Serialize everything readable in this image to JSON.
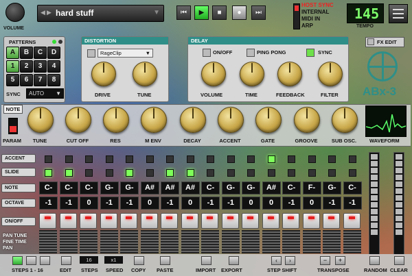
{
  "header": {
    "volume_label": "VOLUME",
    "preset_name": "hard stuff",
    "transport": [
      "⏮",
      "▶",
      "■",
      "●",
      "⏭"
    ],
    "sync_modes": [
      "HOST SYNC",
      "INTERNAL",
      "MIDI IN",
      "ARP"
    ],
    "tempo_value": "145",
    "tempo_label": "TEMPO"
  },
  "patterns": {
    "title": "PATTERNS",
    "letters": [
      "A",
      "B",
      "C",
      "D"
    ],
    "numbers": [
      "1",
      "2",
      "3",
      "4",
      "5",
      "6",
      "7",
      "8"
    ],
    "sync_label": "SYNC",
    "sync_value": "AUTO"
  },
  "distortion": {
    "title": "DISTORTION",
    "type": "RageClip",
    "knobs": [
      "DRIVE",
      "TUNE"
    ]
  },
  "delay": {
    "title": "DELAY",
    "toggles": [
      "ON/OFF",
      "PING PONG",
      "SYNC"
    ],
    "knobs": [
      "VOLUME",
      "TIME",
      "FEEDBACK",
      "FILTER"
    ]
  },
  "fx_edit_label": "FX EDIT",
  "logo_text": "ABx-3",
  "synth": {
    "note_label": "NOTE",
    "param_label": "PARAM",
    "knobs": [
      "TUNE",
      "CUT OFF",
      "RES",
      "M ENV",
      "DECAY",
      "ACCENT",
      "GATE",
      "GROOVE",
      "SUB OSC."
    ],
    "waveform_label": "WAVEFORM"
  },
  "sequencer": {
    "row_labels": [
      "ACCENT",
      "SLIDE",
      "NOTE",
      "OCTAVE",
      "ON/OFF"
    ],
    "fine_labels": [
      "PAN TUNE",
      "FINE TIME",
      "PAN"
    ],
    "accent": [
      0,
      0,
      0,
      0,
      0,
      0,
      0,
      0,
      0,
      0,
      0,
      1,
      0,
      0,
      0,
      0
    ],
    "slide": [
      1,
      1,
      0,
      0,
      1,
      0,
      1,
      1,
      0,
      0,
      0,
      0,
      0,
      0,
      0,
      0
    ],
    "notes": [
      "C-",
      "C-",
      "C-",
      "G-",
      "G-",
      "A#",
      "A#",
      "A#",
      "C-",
      "G-",
      "G-",
      "A#",
      "C-",
      "F-",
      "G-",
      "C-"
    ],
    "octaves": [
      "-1",
      "-1",
      "0",
      "-1",
      "-1",
      "0",
      "-1",
      "0",
      "-1",
      "-1",
      "0",
      "0",
      "-1",
      "0",
      "-1",
      "-1"
    ]
  },
  "footer": {
    "steps_range": "STEPS 1 - 16",
    "edit": "EDIT",
    "steps": "STEPS",
    "steps_value": "16",
    "speed": "SPEED",
    "speed_value": "x1",
    "copy": "COPY",
    "paste": "PASTE",
    "import": "IMPORT",
    "export": "EXPORT",
    "step_shift": "STEP SHIFT",
    "transpose": "TRANSPOSE",
    "random": "RANDOM",
    "clear": "CLEAR"
  }
}
